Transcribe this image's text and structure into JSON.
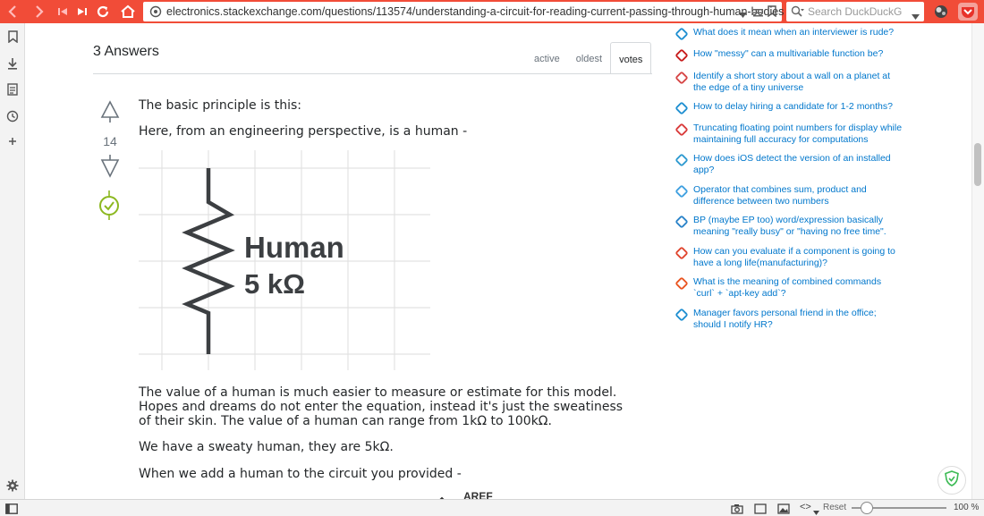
{
  "browser": {
    "url": "electronics.stackexchange.com/questions/113574/understanding-a-circuit-for-reading-current-passing-through-human-bodies",
    "search_placeholder": "Search DuckDuckG",
    "zoom_reset_label": "Reset",
    "zoom_level": "100 %",
    "accent_color": "#f14c38"
  },
  "answers": {
    "count_label": "3 Answers",
    "tabs": [
      "active",
      "oldest",
      "votes"
    ],
    "selected_tab": "votes"
  },
  "answer": {
    "score": "14",
    "accepted": true,
    "paragraphs": [
      "The basic principle is this:",
      "Here, from an engineering perspective, is a human -",
      "The value of a human is much easier to measure or estimate for this model. Hopes and dreams do not enter the equation, instead it's just the sweatiness of their skin. The value of a human can range from 1kΩ to 100kΩ.",
      "We have a sweaty human, they are 5kΩ.",
      "When we add a human to the circuit you provided -"
    ],
    "schematic": {
      "label_name": "Human",
      "label_value": "5 kΩ"
    },
    "cutoff_text": "AREF"
  },
  "hot_network_questions": [
    {
      "title": "What does it mean when an interviewer is rude?",
      "icon": "workplace-icon",
      "color": "#1f8fd1"
    },
    {
      "title": "How \"messy\" can a multivariable function be?",
      "icon": "math-icon",
      "color": "#c71b1b"
    },
    {
      "title": "Identify a short story about a wall on a planet at the edge of a tiny universe",
      "icon": "scifi-icon",
      "color": "#d64545"
    },
    {
      "title": "How to delay hiring a candidate for 1-2 months?",
      "icon": "workplace-icon",
      "color": "#1f8fd1"
    },
    {
      "title": "Truncating floating point numbers for display while maintaining full accuracy for computations",
      "icon": "codereview-icon",
      "color": "#d93a3a"
    },
    {
      "title": "How does iOS detect the version of an installed app?",
      "icon": "apple-icon",
      "color": "#2e9ad0"
    },
    {
      "title": "Operator that combines sum, product and difference between two numbers",
      "icon": "codegolf-icon",
      "color": "#3fa0e0"
    },
    {
      "title": "BP (maybe EP too) word/expression basically meaning \"really busy\" or \"having no free time\".",
      "icon": "portuguese-icon",
      "color": "#2a83c9"
    },
    {
      "title": "How can you evaluate if a component is going to have a long life(manufacturing)?",
      "icon": "engineering-icon",
      "color": "#e0452e"
    },
    {
      "title": "What is the meaning of combined commands `curl` + `apt-key add`?",
      "icon": "askubuntu-icon",
      "color": "#e95420"
    },
    {
      "title": "Manager favors personal friend in the office; should I notify HR?",
      "icon": "workplace-icon",
      "color": "#1f8fd1"
    }
  ]
}
